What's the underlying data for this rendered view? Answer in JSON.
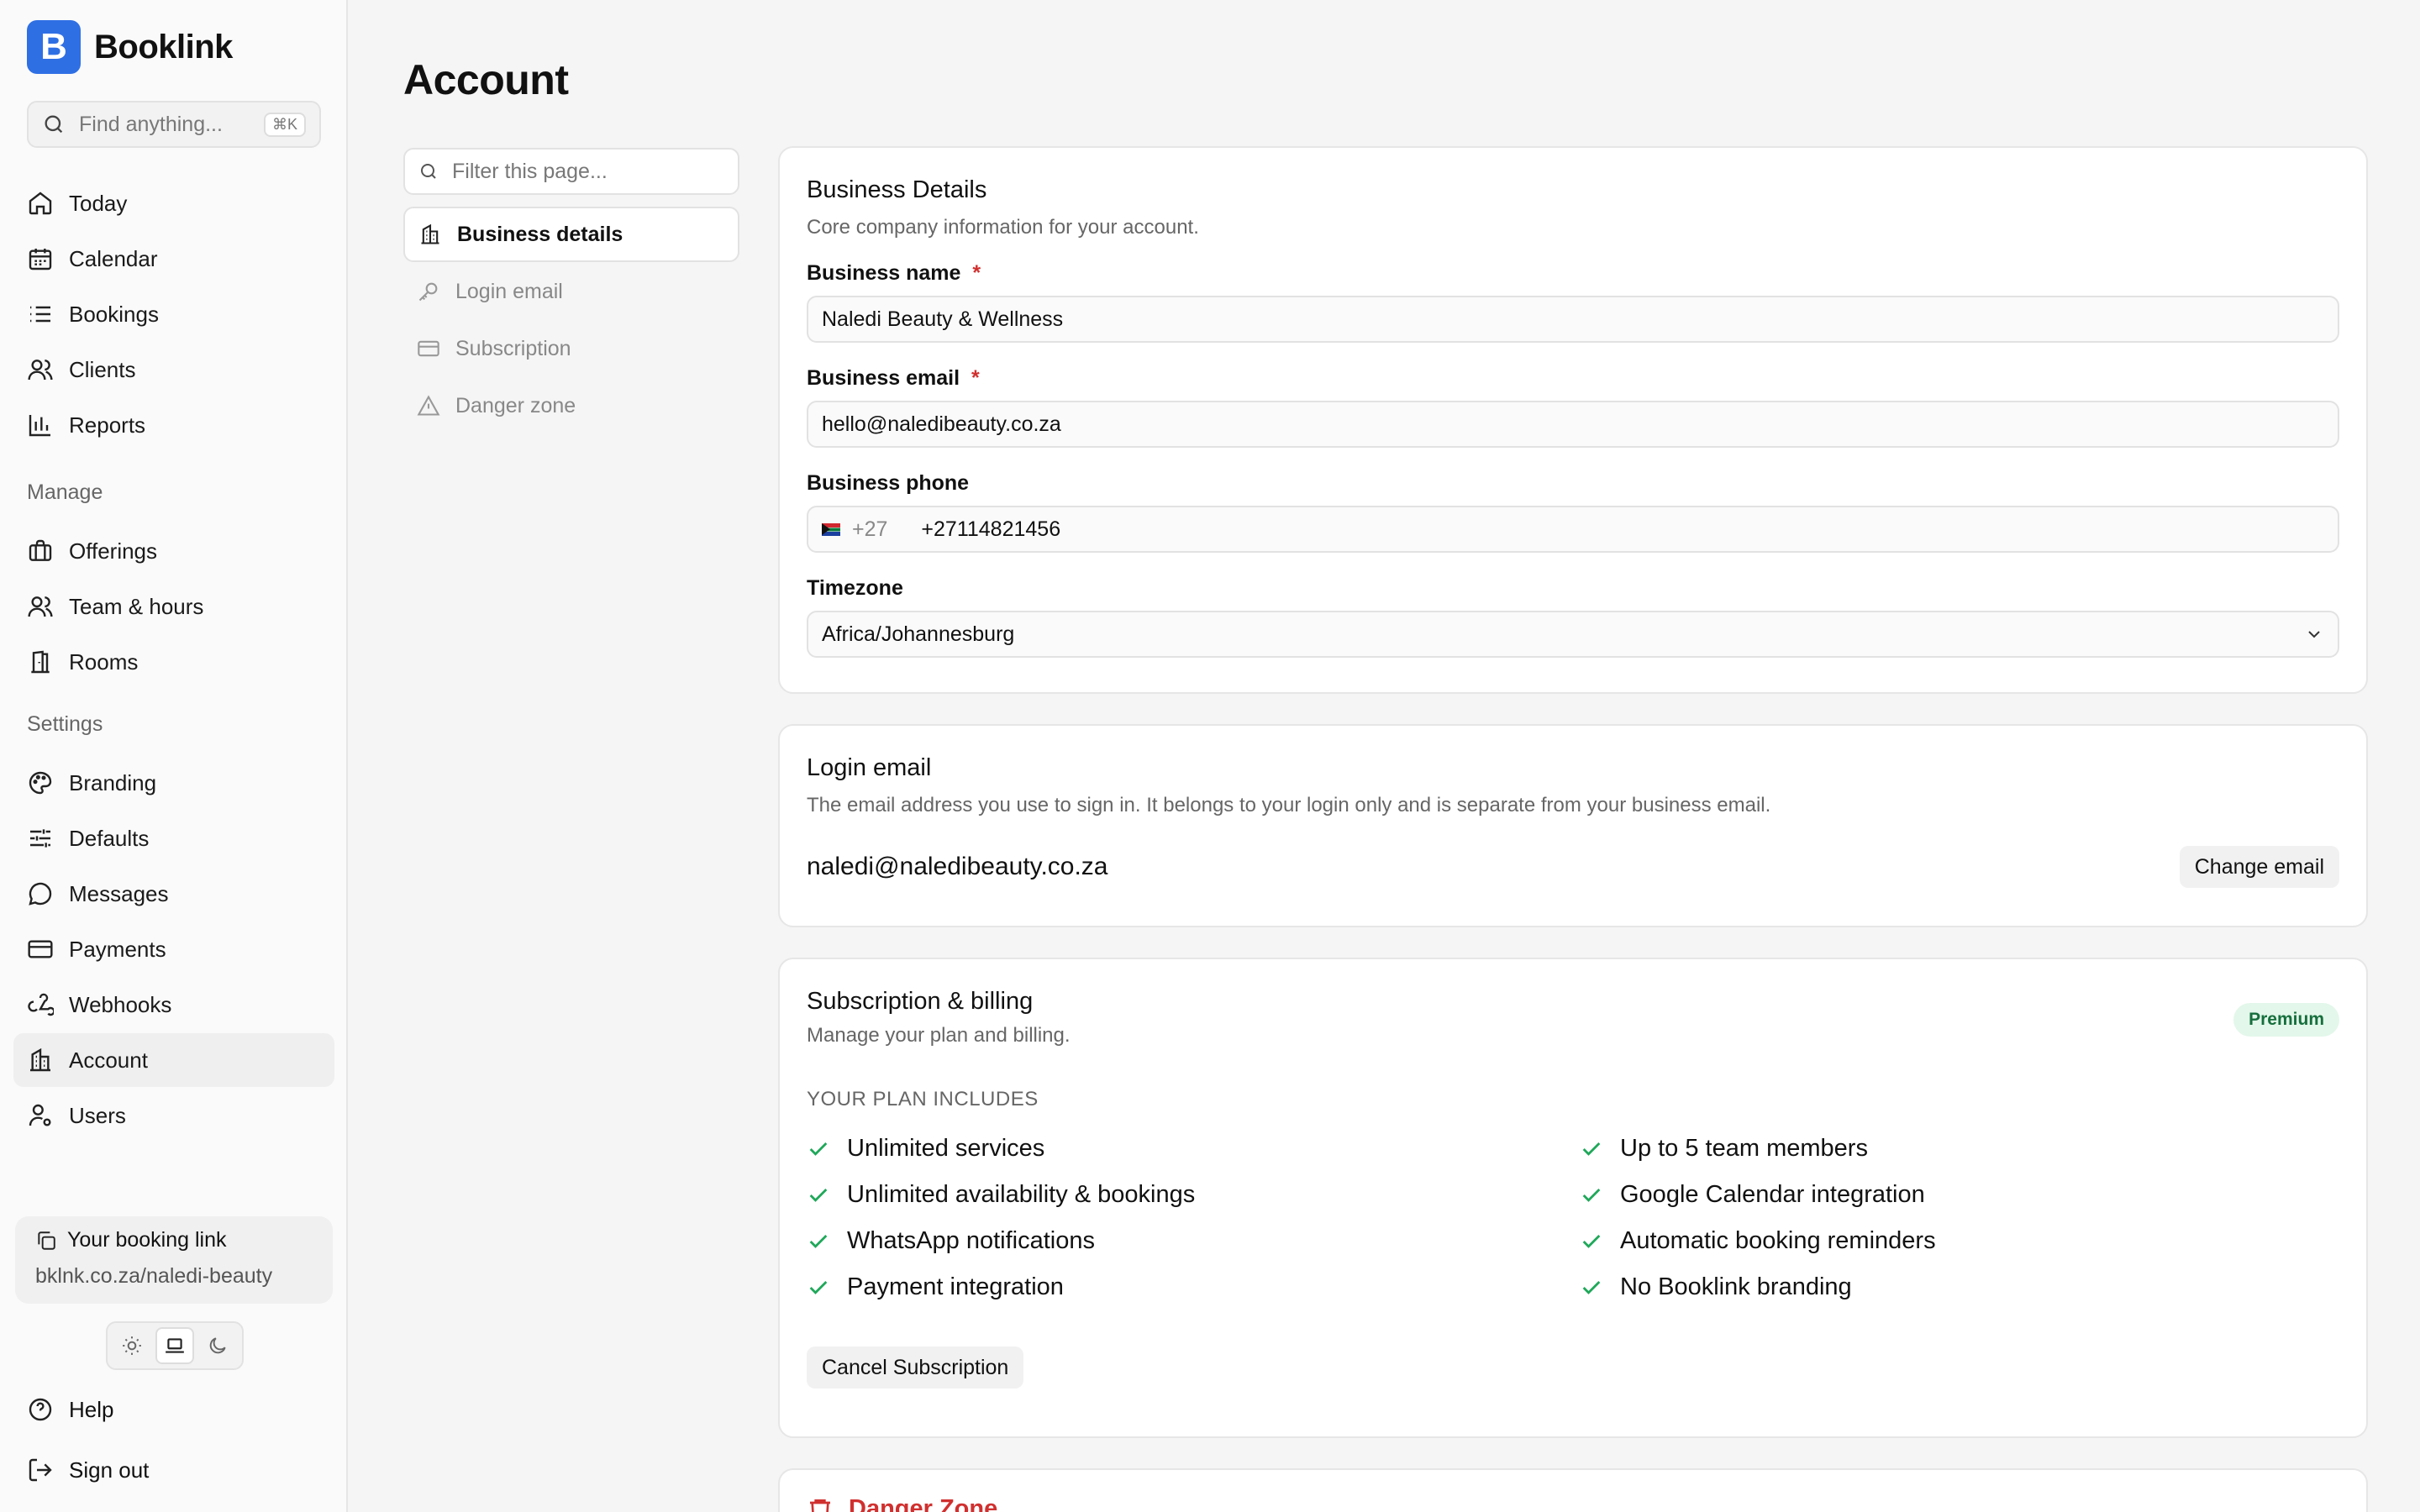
{
  "brand": {
    "logo_letter": "B",
    "name": "Booklink"
  },
  "search": {
    "placeholder": "Find anything...",
    "shortcut": "⌘K"
  },
  "nav": {
    "primary": [
      {
        "label": "Today",
        "icon": "home-icon"
      },
      {
        "label": "Calendar",
        "icon": "calendar-icon"
      },
      {
        "label": "Bookings",
        "icon": "list-icon"
      },
      {
        "label": "Clients",
        "icon": "users-icon"
      },
      {
        "label": "Reports",
        "icon": "bar-chart-icon"
      }
    ],
    "manage_heading": "Manage",
    "manage": [
      {
        "label": "Offerings",
        "icon": "briefcase-icon"
      },
      {
        "label": "Team & hours",
        "icon": "team-icon"
      },
      {
        "label": "Rooms",
        "icon": "door-icon"
      }
    ],
    "settings_heading": "Settings",
    "settings": [
      {
        "label": "Branding",
        "icon": "palette-icon"
      },
      {
        "label": "Defaults",
        "icon": "sliders-icon"
      },
      {
        "label": "Messages",
        "icon": "message-icon"
      },
      {
        "label": "Payments",
        "icon": "credit-card-icon"
      },
      {
        "label": "Webhooks",
        "icon": "webhook-icon"
      },
      {
        "label": "Account",
        "icon": "building-icon",
        "active": true
      },
      {
        "label": "Users",
        "icon": "user-cog-icon"
      }
    ]
  },
  "booking_link": {
    "title": "Your booking link",
    "url": "bklnk.co.za/naledi-beauty"
  },
  "theme": {
    "selected": "system"
  },
  "footer": {
    "help": "Help",
    "sign_out": "Sign out"
  },
  "page": {
    "title": "Account"
  },
  "subnav": {
    "filter_placeholder": "Filter this page...",
    "items": [
      {
        "label": "Business details",
        "icon": "building-icon",
        "active": true
      },
      {
        "label": "Login email",
        "icon": "key-icon"
      },
      {
        "label": "Subscription",
        "icon": "credit-card-icon"
      },
      {
        "label": "Danger zone",
        "icon": "warning-icon"
      }
    ]
  },
  "business": {
    "title": "Business Details",
    "subtitle": "Core company information for your account.",
    "name_label": "Business name",
    "name_value": "Naledi Beauty & Wellness",
    "email_label": "Business email",
    "email_value": "hello@naledibeauty.co.za",
    "phone_label": "Business phone",
    "phone_country_code": "+27",
    "phone_value": "+27114821456",
    "timezone_label": "Timezone",
    "timezone_value": "Africa/Johannesburg",
    "required_mark": "*"
  },
  "login": {
    "title": "Login email",
    "subtitle": "The email address you use to sign in. It belongs to your login only and is separate from your business email.",
    "email": "naledi@naledibeauty.co.za",
    "change_button": "Change email"
  },
  "subscription": {
    "title": "Subscription & billing",
    "subtitle": "Manage your plan and billing.",
    "badge": "Premium",
    "plan_heading": "YOUR PLAN INCLUDES",
    "features": [
      "Unlimited services",
      "Up to 5 team members",
      "Unlimited availability & bookings",
      "Google Calendar integration",
      "WhatsApp notifications",
      "Automatic booking reminders",
      "Payment integration",
      "No Booklink branding"
    ],
    "cancel_button": "Cancel Subscription"
  },
  "danger": {
    "title": "Danger Zone"
  },
  "colors": {
    "brand": "#2f6fe4",
    "check": "#1fa85a",
    "danger": "#d0302f",
    "badge_bg": "#e3f7ea"
  }
}
